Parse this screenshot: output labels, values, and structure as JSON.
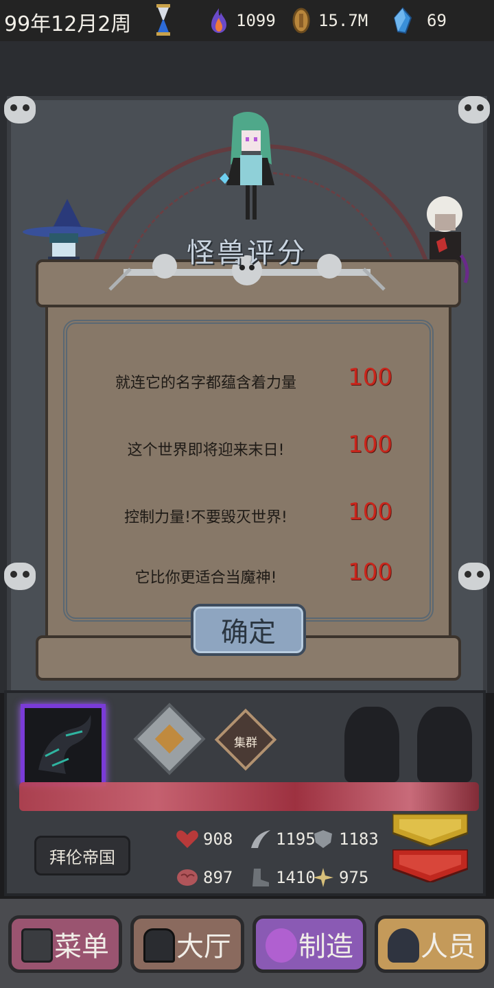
{
  "status_bar": {
    "date": "99年12月2周",
    "flame_value": "1099",
    "coin_value": "15.7M",
    "crystal_value": "69"
  },
  "dialog": {
    "title": "怪兽评分",
    "rows": [
      {
        "text": "就连它的名字都蕴含着力量",
        "score": "100"
      },
      {
        "text": "这个世界即将迎来末日!",
        "score": "100"
      },
      {
        "text": "控制力量!不要毁灭世界!",
        "score": "100"
      },
      {
        "text": "它比你更适合当魔神!",
        "score": "100"
      }
    ],
    "confirm_label": "确定"
  },
  "monster_panel": {
    "group_badge_label": "集群",
    "nation_label": "拜伦帝国",
    "stats": {
      "hp": "908",
      "attack": "1195",
      "defense": "1183",
      "intelligence": "897",
      "speed": "1410",
      "magic": "975"
    }
  },
  "nav": {
    "menu": "菜单",
    "hall": "大厅",
    "craft": "制造",
    "staff": "人员"
  },
  "colors": {
    "score_red": "#c8261c",
    "portrait_glow": "#7a3bd8",
    "gold_chevron": "#c9a227",
    "red_chevron": "#c0281f"
  },
  "icons": [
    "hourglass-icon",
    "flame-icon",
    "coin-icon",
    "crystal-icon",
    "wolf-badge-icon",
    "heart-icon",
    "claw-icon",
    "shield-icon",
    "brain-icon",
    "boot-icon",
    "sparkle-icon",
    "menu-icon",
    "hall-door-icon",
    "craft-icon",
    "staff-icon"
  ]
}
